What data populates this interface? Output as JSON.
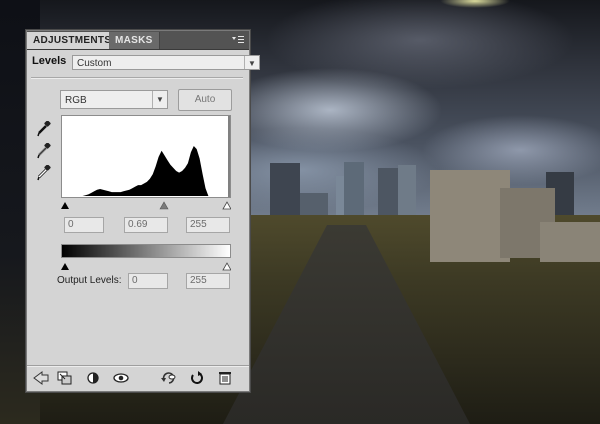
{
  "panel": {
    "tabs": [
      {
        "label": "ADJUSTMENTS",
        "active": true
      },
      {
        "label": "MASKS",
        "active": false
      }
    ],
    "menu_icon": "panel-menu-icon",
    "title": "Levels",
    "preset": {
      "selected": "Custom"
    },
    "channel": {
      "selected": "RGB"
    },
    "auto_label": "Auto",
    "eyedroppers": [
      "black-point-eyedropper-icon",
      "gray-point-eyedropper-icon",
      "white-point-eyedropper-icon"
    ],
    "input_levels": {
      "black": "0",
      "gamma": "0.69",
      "white": "255"
    },
    "output_levels": {
      "label": "Output Levels:",
      "black": "0",
      "white": "255"
    },
    "histogram": {
      "bins": [
        0,
        0,
        0,
        0,
        0,
        0,
        0,
        0,
        1,
        2,
        4,
        6,
        8,
        9,
        8,
        7,
        6,
        5,
        5,
        5,
        5,
        6,
        7,
        8,
        10,
        12,
        14,
        14,
        16,
        18,
        22,
        28,
        38,
        50,
        58,
        52,
        46,
        40,
        36,
        32,
        30,
        32,
        36,
        42,
        56,
        64,
        60,
        48,
        28,
        10,
        0,
        0,
        0,
        0,
        0,
        0
      ],
      "max": 64
    },
    "bottom_tools": [
      "back-arrow-icon",
      "clip-to-layer-icon",
      "mask-visibility-icon",
      "eye-icon",
      "previous-state-icon",
      "reset-icon",
      "trash-icon"
    ]
  },
  "colors": {
    "panel_bg": "#d4d4d4",
    "tab_bar": "#535353"
  }
}
